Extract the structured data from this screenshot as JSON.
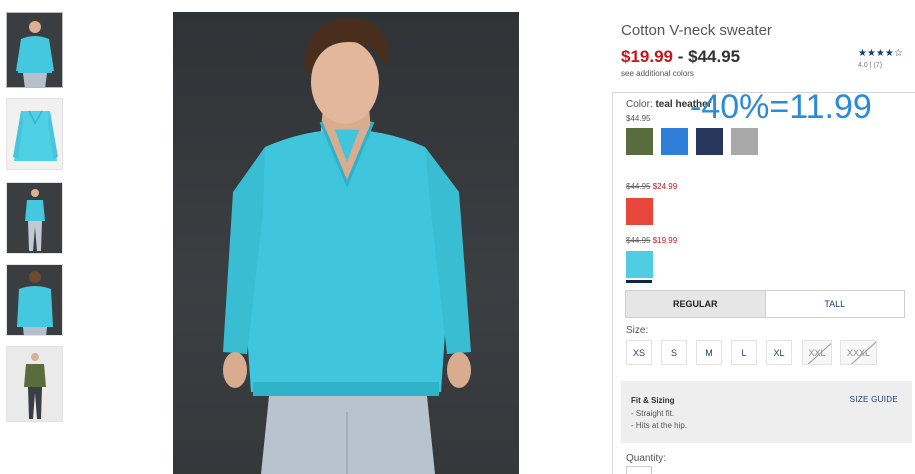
{
  "product": {
    "title": "Cotton V-neck sweater",
    "price_sale": "$19.99",
    "price_separator": " - ",
    "price_regular": "$44.95",
    "see_colors": "see additional colors",
    "rating_stars": "★★★★☆",
    "rating_value": "4.0",
    "rating_sep": "|",
    "rating_count": "(7)"
  },
  "promo_overlay": "-40%=11.99",
  "color": {
    "label": "Color:",
    "selected": "teal heather",
    "groups": [
      {
        "price": "$44.95",
        "swatches": [
          "#5a6b3e",
          "#2f7fd8",
          "#27365c",
          "#a9a9a9"
        ]
      },
      {
        "original": "$44.95",
        "sale": "$24.99",
        "swatches": [
          "#e8463a"
        ]
      },
      {
        "original": "$44.95",
        "sale": "$19.99",
        "swatches": [
          "#4fcde3"
        ]
      }
    ]
  },
  "fit_tabs": [
    "REGULAR",
    "TALL"
  ],
  "size": {
    "label": "Size:",
    "options": [
      "XS",
      "S",
      "M",
      "L",
      "XL",
      "XXL",
      "XXXL"
    ],
    "unavailable": [
      "XXL",
      "XXXL"
    ]
  },
  "fit_sizing": {
    "title": "Fit & Sizing",
    "guide_link": "SIZE GUIDE",
    "notes": [
      "- Straight fit.",
      "- Hits at the hip."
    ]
  },
  "quantity": {
    "label": "Quantity:"
  },
  "colors": {
    "sweater": "#3fc6dc",
    "price_red": "#c4161c",
    "link_blue": "#1a3e72",
    "promo_blue": "#2b8bd6"
  }
}
